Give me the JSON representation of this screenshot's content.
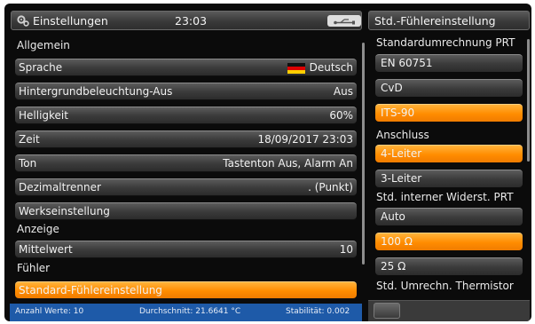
{
  "title_bar": {
    "title": "Einstellungen",
    "time": "23:03",
    "usb_icon": "usb-icon",
    "settings_icon": "gears-icon"
  },
  "right_panel": {
    "title": "Std.-Fühlereinstellung",
    "sections": [
      {
        "label": "Standardumrechnung PRT",
        "options": [
          "EN 60751",
          "CvD",
          "ITS-90"
        ],
        "selected": "ITS-90"
      },
      {
        "label": "Anschluss",
        "options": [
          "4-Leiter",
          "3-Leiter"
        ],
        "selected": "4-Leiter"
      },
      {
        "label": "Std. interner Widerst. PRT",
        "options": [
          "Auto",
          "100 Ω",
          "25 Ω"
        ],
        "selected": "100 Ω"
      },
      {
        "label": "Std. Umrechn. Thermistor",
        "options": [],
        "selected": ""
      }
    ]
  },
  "left_panel": {
    "section_general": "Allgemein",
    "rows": [
      {
        "label": "Sprache",
        "value": "Deutsch",
        "flag": "german-flag"
      },
      {
        "label": "Hintergrundbeleuchtung-Aus",
        "value": "Aus"
      },
      {
        "label": "Helligkeit",
        "value": "60%"
      },
      {
        "label": "Zeit",
        "value": "18/09/2017 23:03"
      },
      {
        "label": "Ton",
        "value": "Tastenton Aus, Alarm An"
      },
      {
        "label": "Dezimaltrenner",
        "value": ". (Punkt)"
      },
      {
        "label": "Werkseinstellung",
        "value": ""
      }
    ],
    "section_display": "Anzeige",
    "display_rows": [
      {
        "label": "Mittelwert",
        "value": "10"
      }
    ],
    "section_sensor": "Fühler",
    "sensor_rows": [
      {
        "label": "Standard-Fühlereinstellung",
        "value": "",
        "selected": true
      }
    ]
  },
  "status_bar": {
    "count": "Anzahl Werte: 10",
    "average": "Durchschnitt: 21.6641 °C",
    "stability": "Stabilität: 0.002"
  },
  "colors": {
    "accent_orange": "#ff8c00",
    "status_blue": "#1e5aa8",
    "background": "#0b0b0b"
  }
}
